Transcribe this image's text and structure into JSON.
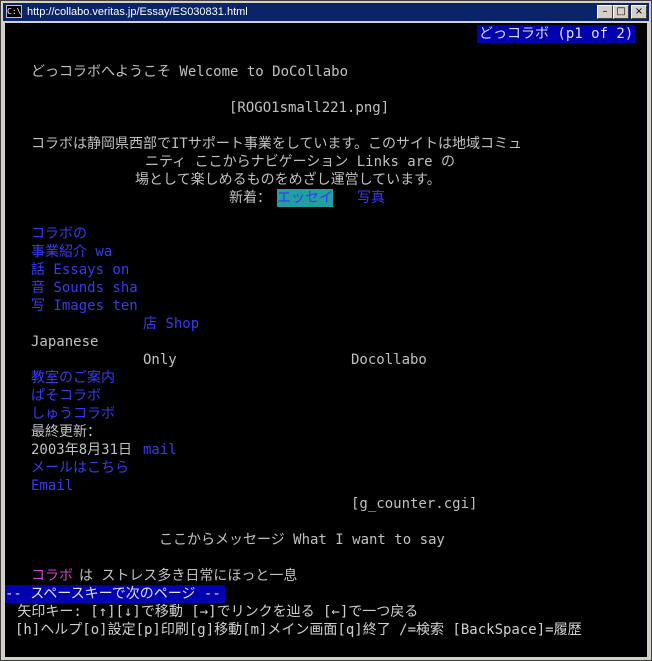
{
  "window": {
    "title": "http://collabo.veritas.jp/Essay/ES030831.html",
    "icon_label": "C:\\",
    "minimize_glyph": "–",
    "maximize_glyph": "□",
    "close_glyph": "×"
  },
  "header": {
    "page_indicator": "どっコラボ (p1 of 2)"
  },
  "content": {
    "welcome": "どっコラボへようこそ Welcome to DoCollabo",
    "logo_image": "[ROGO1small221.png]",
    "intro_1": "コラボは静岡県西部でITサポート事業をしています。このサイトは地域コミュ",
    "intro_2": "ニティ ここからナビゲーション Links are の",
    "intro_3": "場として楽しめるものをめざし運営しています。",
    "new_label": "新着：",
    "new_link_essay": "エッセイ",
    "new_link_photo": "写真",
    "nav_1": "コラボの",
    "nav_2": "事業紹介 wa",
    "nav_3": "話 Essays on",
    "nav_4": "音 Sounds sha",
    "nav_5": "写 Images ten",
    "nav_6": "店 Shop",
    "japanese": "Japanese",
    "only": "Only",
    "docollabo": "Docollabo",
    "nav_7": "教室のご案内",
    "nav_8": "ぱそコラボ",
    "nav_9": "しゅうコラボ",
    "updated_label": "最終更新：",
    "updated_date": "2003年8月31日",
    "mail_link": "mail",
    "mail_text": "メールはこちら",
    "email_link": "Email",
    "counter": "[g_counter.cgi]",
    "message_heading": "ここからメッセージ What I want to say",
    "collabo_word": "コラボ",
    "message_text": "は ストレス多き日常にほっと一息"
  },
  "statusbar": {
    "next_page": "-- スペースキーで次のページ --",
    "keys_help": " 矢印キー: [↑][↓]で移動 [→]でリンクを辿る [←]で一つ戻る",
    "commands_help": "[h]ヘルプ[o]設定[p]印刷[g]移動[m]メイン画面[q]終了 /=検索 [BackSpace]=履歴"
  }
}
